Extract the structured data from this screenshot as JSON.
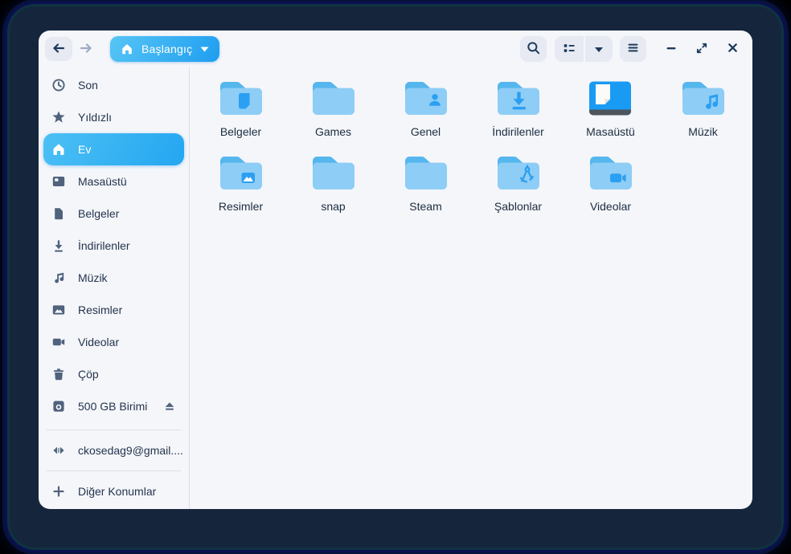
{
  "toolbar": {
    "location_label": "Başlangıç",
    "icons": [
      "back-icon",
      "forward-icon",
      "home-icon",
      "caret-down-icon",
      "search-icon",
      "list-view-icon",
      "view-options-caret-icon",
      "menu-icon",
      "minimize-icon",
      "maximize-icon",
      "close-icon"
    ]
  },
  "sidebar": {
    "items": [
      {
        "label": "Son",
        "icon": "clock-icon"
      },
      {
        "label": "Yıldızlı",
        "icon": "star-icon"
      },
      {
        "label": "Ev",
        "icon": "home-icon",
        "selected": true
      },
      {
        "label": "Masaüstü",
        "icon": "desktop-icon"
      },
      {
        "label": "Belgeler",
        "icon": "document-icon"
      },
      {
        "label": "İndirilenler",
        "icon": "download-icon"
      },
      {
        "label": "Müzik",
        "icon": "music-icon"
      },
      {
        "label": "Resimler",
        "icon": "image-icon"
      },
      {
        "label": "Videolar",
        "icon": "video-icon"
      },
      {
        "label": "Çöp",
        "icon": "trash-icon"
      },
      {
        "label": "500 GB Birimi",
        "icon": "drive-icon",
        "trailing_icon": "eject-icon"
      }
    ],
    "footer_items": [
      {
        "label": "ckosedag9@gmail....",
        "icon": "network-icon"
      },
      {
        "label": "Diğer Konumlar",
        "icon": "plus-icon"
      }
    ]
  },
  "grid": {
    "items": [
      {
        "label": "Belgeler",
        "icon": "folder-icon",
        "emblem": "document"
      },
      {
        "label": "Games",
        "icon": "folder-icon",
        "emblem": "none"
      },
      {
        "label": "Genel",
        "icon": "folder-icon",
        "emblem": "person"
      },
      {
        "label": "İndirilenler",
        "icon": "folder-icon",
        "emblem": "download"
      },
      {
        "label": "Masaüstü",
        "icon": "desktop-icon",
        "emblem": "none"
      },
      {
        "label": "Müzik",
        "icon": "folder-icon",
        "emblem": "music"
      },
      {
        "label": "Resimler",
        "icon": "folder-icon",
        "emblem": "image"
      },
      {
        "label": "snap",
        "icon": "folder-icon",
        "emblem": "none"
      },
      {
        "label": "Steam",
        "icon": "folder-icon",
        "emblem": "none"
      },
      {
        "label": "Şablonlar",
        "icon": "folder-icon",
        "emblem": "compass"
      },
      {
        "label": "Videolar",
        "icon": "folder-icon",
        "emblem": "camera"
      }
    ]
  },
  "colors": {
    "accent_gradient_start": "#57c5f5",
    "accent_gradient_end": "#1f9ef0",
    "folder_body": "#8ecdf5",
    "folder_tab": "#56b6ee",
    "folder_emblem": "#2b9ff2",
    "desktop_icon_blue": "#1a9bf3",
    "desktop_icon_bar": "#4d545c",
    "window_bg": "#f4f6fa",
    "toolbar_button_bg": "#e7eaf2",
    "toolbar_icon": "#1e3a5c",
    "disabled_icon": "#9cabc0",
    "sidebar_icon": "#50627c",
    "frame_bg": "#15263c"
  }
}
